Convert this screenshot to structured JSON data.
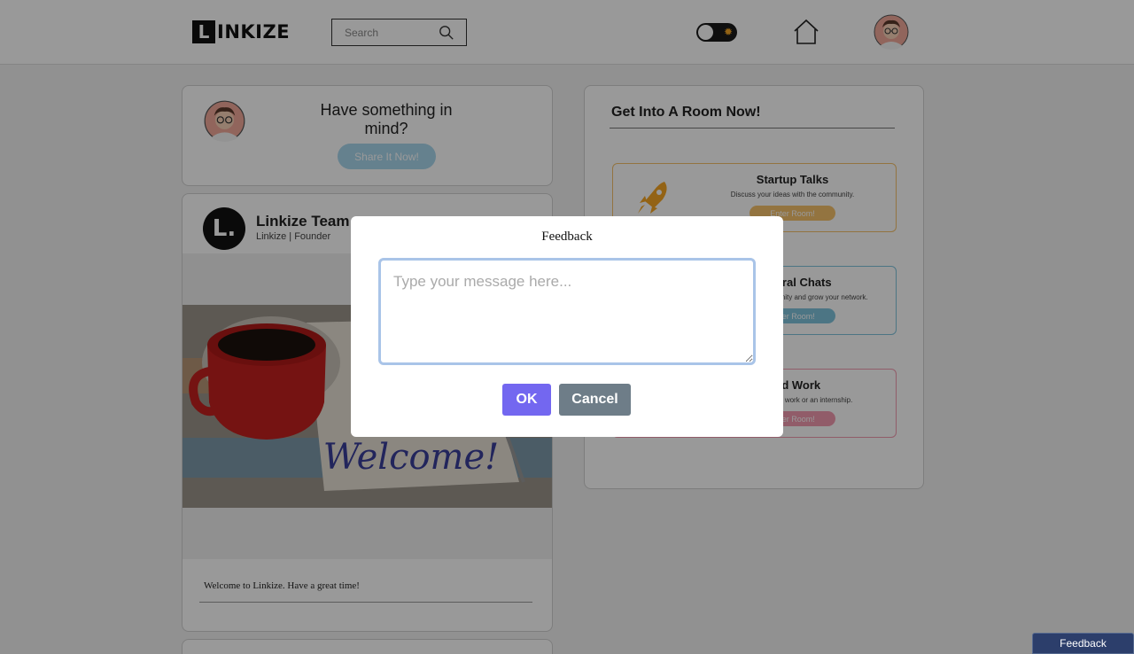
{
  "header": {
    "logo_letter": "L",
    "logo_text": "INKIZE",
    "search_placeholder": "Search",
    "toggle_icon": "sun-icon",
    "home_icon": "home-icon",
    "avatar_icon": "user-avatar"
  },
  "compose": {
    "prompt": "Have something in mind?",
    "share_label": "Share It Now!"
  },
  "post": {
    "avatar_letter": "L.",
    "author": "Linkize Team",
    "role": "Linkize | Founder",
    "image_text": "Welcome!",
    "caption": "Welcome to Linkize. Have a great time!"
  },
  "rooms": {
    "title": "Get Into A Room Now!",
    "items": [
      {
        "title": "Startup Talks",
        "desc": "Discuss your ideas with the community.",
        "button": "Enter Room!",
        "color": "#f5c16c",
        "icon": "rocket-icon"
      },
      {
        "title": "General Chats",
        "desc": "Talk with the community and grow your network.",
        "button": "Enter Room!",
        "color": "#7fc4dd",
        "icon": "chat-icon"
      },
      {
        "title": "Find Work",
        "desc": "Find freelancing work or an internship.",
        "button": "Enter Room!",
        "color": "#f29ab0",
        "icon": "briefcase-icon"
      }
    ]
  },
  "modal": {
    "title": "Feedback",
    "placeholder": "Type your message here...",
    "ok_label": "OK",
    "cancel_label": "Cancel"
  },
  "feedback_tab": "Feedback",
  "colors": {
    "accent": "#7367f0",
    "cancel": "#6e7d88",
    "share": "#a9d7ed",
    "feedback_tab": "#2c3e6b"
  }
}
